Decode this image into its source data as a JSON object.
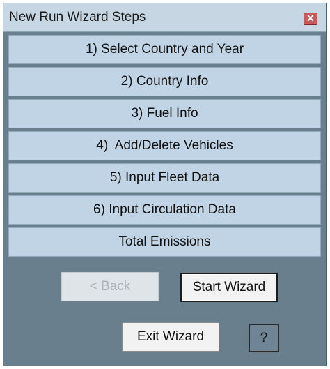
{
  "window": {
    "title": "New Run Wizard Steps",
    "close_glyph": "✕"
  },
  "steps": [
    {
      "label": "1) Select Country and Year"
    },
    {
      "label": "2) Country Info"
    },
    {
      "label": "3) Fuel Info"
    },
    {
      "label": "4)  Add/Delete Vehicles"
    },
    {
      "label": "5) Input Fleet Data"
    },
    {
      "label": "6) Input Circulation Data"
    },
    {
      "label": "Total Emissions"
    }
  ],
  "buttons": {
    "back": {
      "label": "< Back",
      "enabled": false
    },
    "start": {
      "label": "Start Wizard"
    },
    "exit": {
      "label": "Exit Wizard"
    },
    "help": {
      "label": "?"
    }
  }
}
